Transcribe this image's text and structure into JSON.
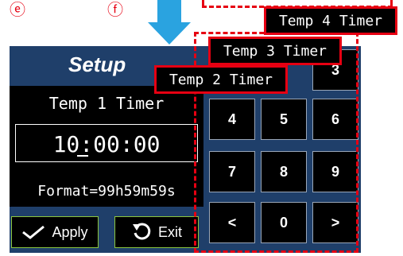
{
  "callouts": {
    "e": "ⓔ",
    "f": "ⓕ"
  },
  "screen": {
    "title": "Setup",
    "timer_label": "Temp 1 Timer",
    "time_value": "10:00:00",
    "format": "Format=99h59m59s",
    "apply_label": "Apply",
    "exit_label": "Exit"
  },
  "keypad": {
    "keys": [
      "3",
      "4",
      "5",
      "6",
      "7",
      "8",
      "9",
      "<",
      "0",
      ">"
    ]
  },
  "tabs": {
    "temp4": "Temp 4 Timer",
    "temp3": "Temp 3 Timer",
    "temp2": "Temp 2 Timer"
  },
  "colors": {
    "accent_red": "#e60012",
    "frame_blue": "#1f3f6a",
    "arrow_blue": "#2aa3e0",
    "button_border_green": "#8cc63f"
  },
  "icons": {
    "apply": "checkmark-icon",
    "exit": "return-arrow-icon",
    "arrow": "down-arrow-icon"
  }
}
